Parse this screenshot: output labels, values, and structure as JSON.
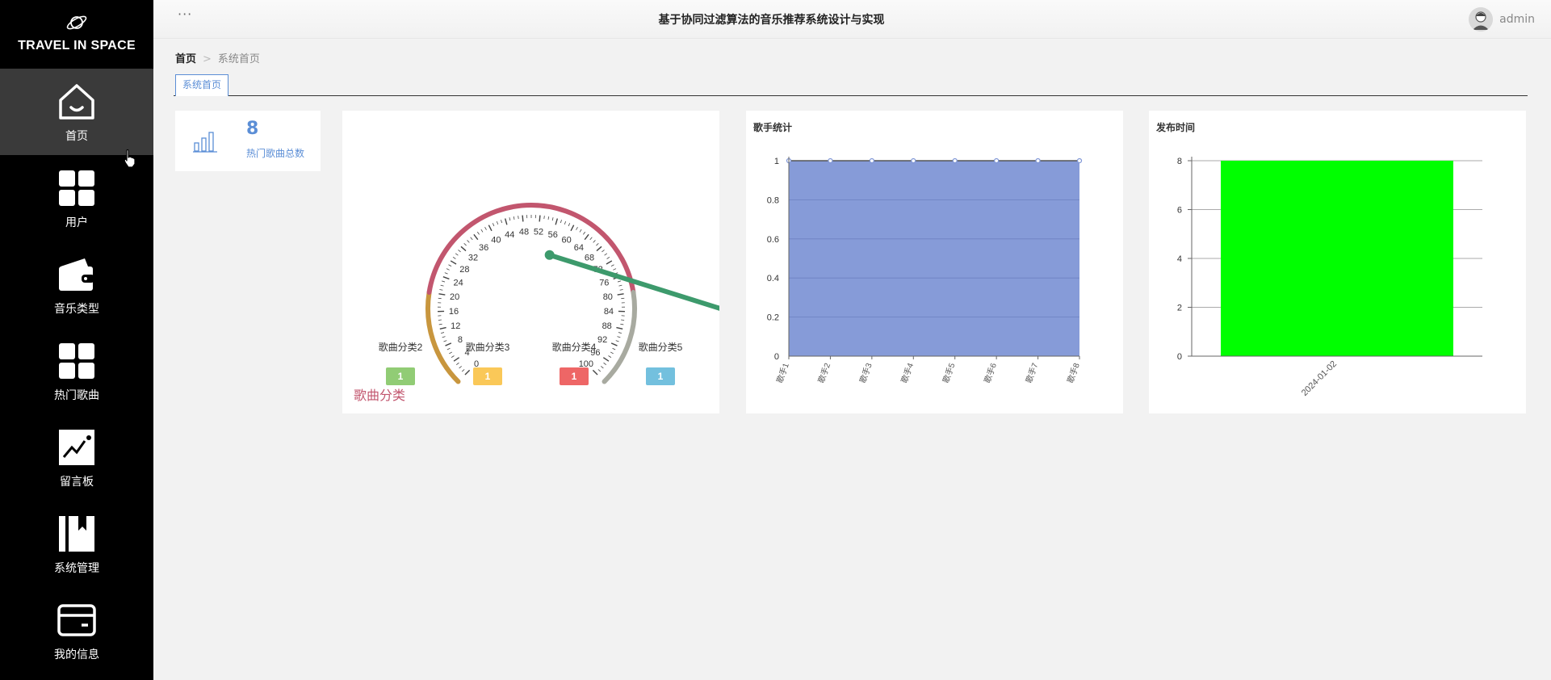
{
  "sidebar": {
    "brand": "TRAVEL IN SPACE",
    "items": [
      {
        "label": "首页",
        "icon": "home-icon",
        "active": true
      },
      {
        "label": "用户",
        "icon": "grid-icon"
      },
      {
        "label": "音乐类型",
        "icon": "wallet-icon"
      },
      {
        "label": "热门歌曲",
        "icon": "grid-icon"
      },
      {
        "label": "留言板",
        "icon": "trend-chart-icon"
      },
      {
        "label": "系统管理",
        "icon": "bookmark-book-icon"
      },
      {
        "label": "我的信息",
        "icon": "card-icon"
      }
    ]
  },
  "topbar": {
    "menu_dots": "···",
    "title": "基于协同过滤算法的音乐推荐系统设计与实现",
    "username": "admin"
  },
  "breadcrumb": {
    "home": "首页",
    "separator": ">",
    "current": "系统首页"
  },
  "tabs": [
    {
      "label": "系统首页"
    }
  ],
  "stat": {
    "value": "8",
    "label": "热门歌曲总数",
    "color": "#5b8ed6"
  },
  "gauge": {
    "title": "歌曲分类",
    "min": 0,
    "max": 100,
    "value": 57,
    "tick_labels": [
      "0",
      "4",
      "8",
      "12",
      "16",
      "20",
      "24",
      "28",
      "32",
      "36",
      "40",
      "44",
      "48",
      "52",
      "56",
      "60",
      "64",
      "68",
      "72",
      "76",
      "80",
      "84",
      "88",
      "92",
      "96",
      "100"
    ],
    "categories": [
      {
        "name": "歌曲分类2",
        "value": "1",
        "color": "#91cc75"
      },
      {
        "name": "歌曲分类3",
        "value": "1",
        "color": "#fac858"
      },
      {
        "name": "歌曲分类4",
        "value": "1",
        "color": "#ee6666"
      },
      {
        "name": "歌曲分类5",
        "value": "1",
        "color": "#73c0de"
      }
    ],
    "arc_colors": {
      "low": "#c8963e",
      "mid": "#c2566e",
      "high": "#a8aaa0"
    },
    "pointer_color": "#3d9a6c"
  },
  "chart_data": [
    {
      "type": "area",
      "title": "歌手统计",
      "categories": [
        "歌手1",
        "歌手2",
        "歌手3",
        "歌手4",
        "歌手5",
        "歌手6",
        "歌手7",
        "歌手8"
      ],
      "series": [
        {
          "values": [
            1,
            1,
            1,
            1,
            1,
            1,
            1,
            1
          ]
        }
      ],
      "ylim": [
        0,
        1
      ],
      "yticks": [
        "0",
        "0.2",
        "0.4",
        "0.6",
        "0.8",
        "1"
      ],
      "grid": true,
      "color": "#7f96d6"
    },
    {
      "type": "bar",
      "title": "发布时间",
      "categories": [
        "2024-01-02"
      ],
      "values": [
        8
      ],
      "ylim": [
        0,
        8
      ],
      "yticks": [
        "0",
        "2",
        "4",
        "6",
        "8"
      ],
      "grid": true,
      "color": "#00ff00"
    }
  ]
}
